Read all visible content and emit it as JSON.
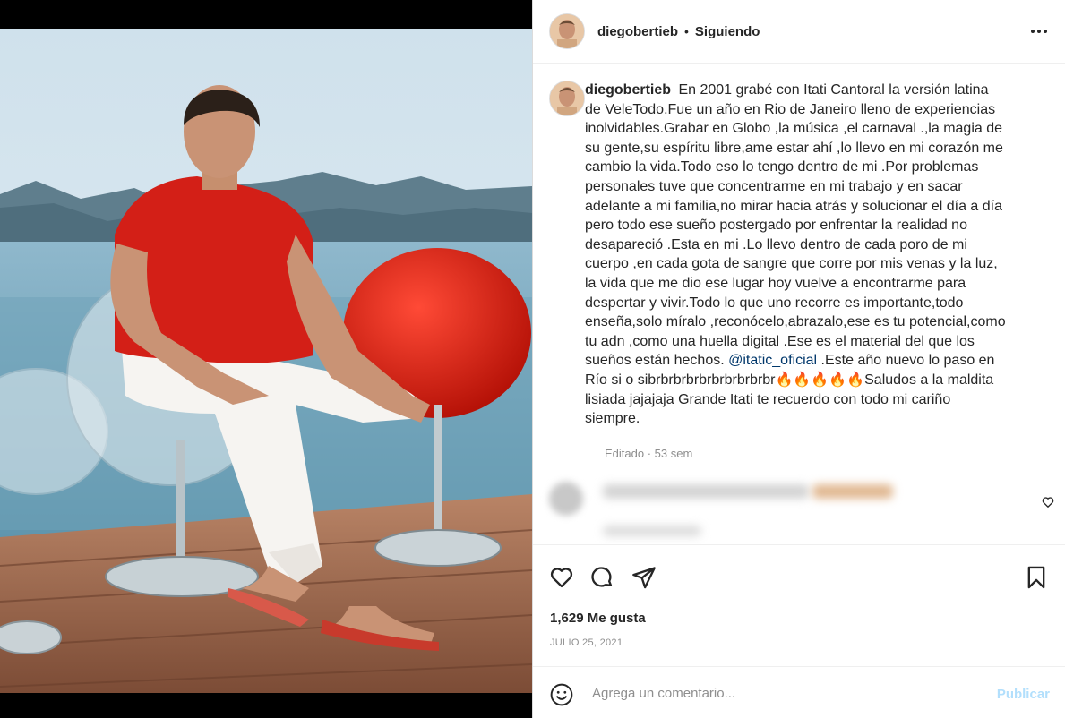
{
  "post": {
    "username": "diegobertieb",
    "separator": "•",
    "follow_status": "Siguiendo",
    "caption_before_mention": "En 2001 grabé con Itati Cantoral la versión latina de VeleTodo.Fue un año en Rio de Janeiro lleno de experiencias inolvidables.Grabar en Globo ,la música ,el carnaval .,la magia de su gente,su espíritu libre,ame estar ahí ,lo llevo en mi corazón me cambio la vida.Todo eso lo tengo dentro de mi .Por problemas personales tuve que concentrarme en mi trabajo y en sacar adelante a mi familia,no mirar hacia atrás y solucionar el día a día pero todo ese sueño postergado por enfrentar la realidad no desapareció .Esta en mi .Lo llevo dentro de cada poro de mi cuerpo ,en cada gota de sangre que corre por mis venas y la luz, la vida que me dio ese lugar hoy vuelve a encontrarme para despertar y vivir.Todo lo que uno recorre es importante,todo enseña,solo míralo ,reconócelo,abrazalo,ese es tu potencial,como tu adn ,como una huella digital .Ese es el material del que los sueños están hechos.",
    "mention": "@itatic_oficial",
    "caption_after_mention": ".Este año nuevo lo paso en Río si o sibrbrbrbrbrbrbrbrbrbr🔥🔥🔥🔥🔥Saludos a la maldita lisiada jajajaja Grande Itati te recuerdo con todo mi cariño siempre.",
    "edited_label": "Editado · 53 sem",
    "likes": "1,629 Me gusta",
    "date": "JULIO 25, 2021"
  },
  "comment_box": {
    "placeholder": "Agrega un comentario...",
    "post_label": "Publicar"
  },
  "colors": {
    "link": "#00376b",
    "publish_disabled": "#b2dffc",
    "muted": "#8e8e8e"
  },
  "icons": [
    "more-options-icon",
    "like-icon",
    "comment-icon",
    "share-icon",
    "save-icon",
    "emoji-icon",
    "comment-like-icon"
  ]
}
